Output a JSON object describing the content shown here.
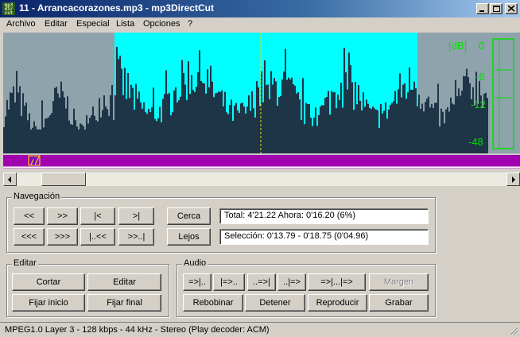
{
  "window": {
    "title": "11 - Arrancacorazones.mp3 - mp3DirectCut",
    "icon_label": "mp3 direct cut"
  },
  "menu": [
    "Archivo",
    "Editar",
    "Especial",
    "Lista",
    "Opciones",
    "?"
  ],
  "meter": {
    "db_label": "[dB]",
    "levels": [
      "0",
      "-6",
      "-12",
      "-48"
    ]
  },
  "navegacion": {
    "label": "Navegación",
    "buttons": [
      "<<",
      ">>",
      "|<",
      ">|",
      "<<<",
      ">>>",
      "|..<<",
      ">>..|"
    ],
    "cerca": "Cerca",
    "lejos": "Lejos",
    "info_line": "Total: 4'21.22   Ahora: 0'16.20   (6%)",
    "selection_line": "Selección: 0'13.79 - 0'18.75 (0'04.96)"
  },
  "editar": {
    "label": "Editar",
    "cortar": "Cortar",
    "editar": "Editar",
    "fijar_inicio": "Fijar inicio",
    "fijar_final": "Fijar final"
  },
  "audio": {
    "label": "Audio",
    "row1": [
      "=>|..",
      "|=>..",
      "..=>|",
      "..|=>",
      "=>|...|=>"
    ],
    "margen": "Margen",
    "rebobinar": "Rebobinar",
    "detener": "Detener",
    "reproducir": "Reproducir",
    "grabar": "Grabar"
  },
  "status": "MPEG1.0 Layer 3 - 128 kbps - 44 kHz - Stereo   (Play decoder: ACM)",
  "colors": {
    "wave_bg": "#8fa3ac",
    "selection": "#00ffff",
    "wave_fill": "#1e3447",
    "meter_green": "#00e000",
    "timeline": "#a000b0"
  }
}
